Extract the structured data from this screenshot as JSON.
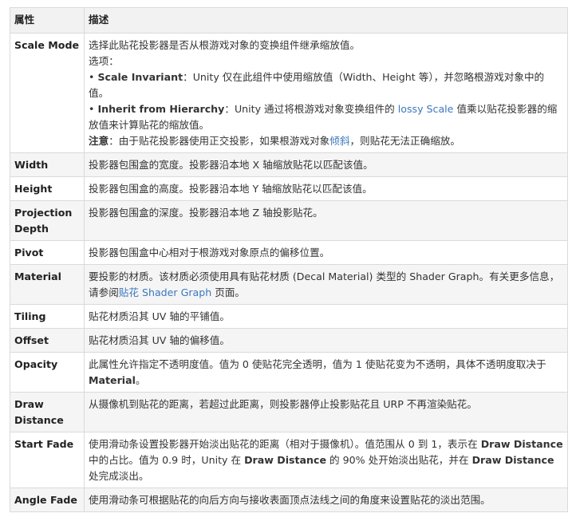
{
  "headers": {
    "property": "属性",
    "description": "描述"
  },
  "rows": [
    {
      "name": "Scale Mode",
      "lines": [
        [
          {
            "t": "选择此贴花投影器是否从根游戏对象的变换组件继承缩放值。"
          }
        ],
        [
          {
            "t": "选项："
          }
        ],
        [
          {
            "t": "• "
          },
          {
            "t": "Scale Invariant",
            "b": true
          },
          {
            "t": "：Unity 仅在此组件中使用缩放值（Width、Height 等），并忽略根游戏对象中的值。"
          }
        ],
        [
          {
            "t": "• "
          },
          {
            "t": "Inherit from Hierarchy",
            "b": true
          },
          {
            "t": "：Unity 通过将根游戏对象变换组件的 "
          },
          {
            "t": "lossy Scale",
            "link": true
          },
          {
            "t": " 值乘以贴花投影器的缩放值来计算贴花的缩放值。"
          }
        ],
        [
          {
            "t": "注意",
            "b": true
          },
          {
            "t": "：由于贴花投影器使用正交投影，如果根游戏对象"
          },
          {
            "t": "倾斜",
            "link": true
          },
          {
            "t": "，则贴花无法正确缩放。"
          }
        ]
      ]
    },
    {
      "name": "Width",
      "lines": [
        [
          {
            "t": "投影器包围盒的宽度。投影器沿本地 X 轴缩放贴花以匹配该值。"
          }
        ]
      ]
    },
    {
      "name": "Height",
      "lines": [
        [
          {
            "t": "投影器包围盒的高度。投影器沿本地 Y 轴缩放贴花以匹配该值。"
          }
        ]
      ]
    },
    {
      "name": "Projection Depth",
      "lines": [
        [
          {
            "t": "投影器包围盒的深度。投影器沿本地 Z 轴投影贴花。"
          }
        ]
      ]
    },
    {
      "name": "Pivot",
      "lines": [
        [
          {
            "t": "投影器包围盒中心相对于根游戏对象原点的偏移位置。"
          }
        ]
      ]
    },
    {
      "name": "Material",
      "lines": [
        [
          {
            "t": "要投影的材质。该材质必须使用具有贴花材质 (Decal Material) 类型的 Shader Graph。有关更多信息，请参阅"
          },
          {
            "t": "贴花 Shader Graph",
            "link": true
          },
          {
            "t": " 页面。"
          }
        ]
      ]
    },
    {
      "name": "Tiling",
      "lines": [
        [
          {
            "t": "贴花材质沿其 UV 轴的平铺值。"
          }
        ]
      ]
    },
    {
      "name": "Offset",
      "lines": [
        [
          {
            "t": "贴花材质沿其 UV 轴的偏移值。"
          }
        ]
      ]
    },
    {
      "name": "Opacity",
      "lines": [
        [
          {
            "t": "此属性允许指定不透明度值。值为 0 使贴花完全透明，值为 1 使贴花变为不透明，具体不透明度取决于 "
          },
          {
            "t": "Material",
            "b": true
          },
          {
            "t": "。"
          }
        ]
      ]
    },
    {
      "name": "Draw Distance",
      "lines": [
        [
          {
            "t": "从摄像机到贴花的距离，若超过此距离，则投影器停止投影贴花且 URP 不再渲染贴花。"
          }
        ]
      ]
    },
    {
      "name": "Start Fade",
      "lines": [
        [
          {
            "t": "使用滑动条设置投影器开始淡出贴花的距离（相对于摄像机）。值范围从 0 到 1，表示在 "
          },
          {
            "t": "Draw Distance",
            "b": true
          },
          {
            "t": " 中的占比。值为 0.9 时，Unity 在 "
          },
          {
            "t": "Draw Distance",
            "b": true
          },
          {
            "t": " 的 90% 处开始淡出贴花，并在 "
          },
          {
            "t": "Draw Distance",
            "b": true
          },
          {
            "t": " 处完成淡出。"
          }
        ]
      ]
    },
    {
      "name": "Angle Fade",
      "lines": [
        [
          {
            "t": "使用滑动条可根据贴花的向后方向与接收表面顶点法线之间的角度来设置贴花的淡出范围。"
          }
        ]
      ]
    }
  ]
}
